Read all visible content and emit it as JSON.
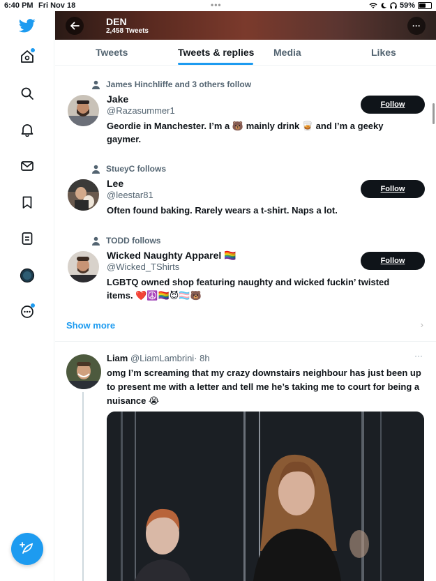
{
  "status_bar": {
    "time": "6:40 PM",
    "date": "Fri Nov 18",
    "battery": "59%",
    "battery_level": 0.59
  },
  "header": {
    "name": "DEN",
    "tweet_count": "2,458 Tweets"
  },
  "tabs": [
    {
      "label": "Tweets"
    },
    {
      "label": "Tweets & replies",
      "active": true
    },
    {
      "label": "Media"
    },
    {
      "label": "Likes"
    }
  ],
  "suggestions": [
    {
      "follows": "James Hinchliffe and 3 others follow",
      "name": "Jake",
      "handle": "@Razasummer1",
      "bio": "Geordie in Manchester. I’m a 🐻 mainly drink 🥃 and I’m a geeky gaymer.",
      "follow_label": "Follow"
    },
    {
      "follows": "StueyC follows",
      "name": "Lee",
      "handle": "@leestar81",
      "bio": "Often found baking. Rarely wears a t-shirt. Naps a lot.",
      "follow_label": "Follow"
    },
    {
      "follows": "TODD follows",
      "name": "Wicked Naughty Apparel 🏳️‍🌈",
      "handle": "@Wicked_TShirts",
      "bio": "LGBTQ owned shop featuring naughty and wicked fuckin’ twisted items. ❤️☮️🏳️‍🌈😈🏳️‍⚧️🐻",
      "follow_label": "Follow"
    }
  ],
  "show_more": "Show more",
  "tweet": {
    "name": "Liam",
    "handle": "@LiamLambrini",
    "time": "· 8h",
    "text": "omg I’m screaming that my crazy downstairs neighbour has just been up to present me with a letter and tell me he’s taking me to court for being a nuisance 😭"
  },
  "icons": {
    "nav": [
      "twitter-logo-icon",
      "home-icon",
      "search-icon",
      "bell-icon",
      "mail-icon",
      "bookmark-icon",
      "lists-icon",
      "profile-icon",
      "more-icon"
    ],
    "compose": "compose-tweet-icon"
  },
  "colors": {
    "accent": "#1d9bf0",
    "text": "#0f1419",
    "muted": "#536471"
  }
}
